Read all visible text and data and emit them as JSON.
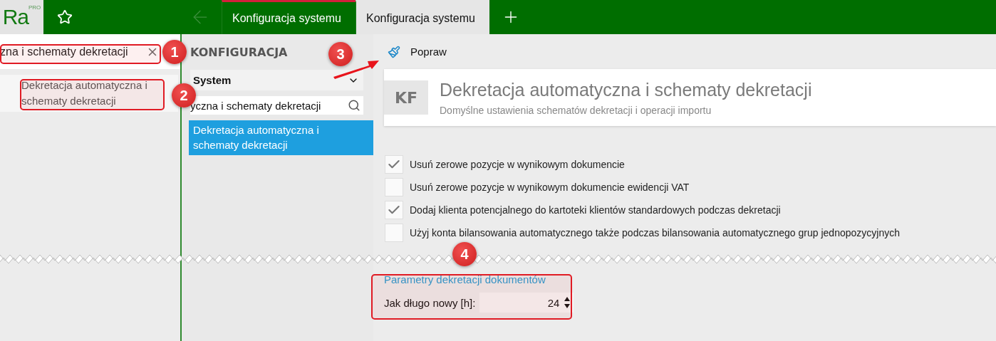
{
  "topbar": {
    "logo": {
      "text": "Ra",
      "badge": "PRO"
    },
    "tabs": [
      {
        "label": "Konfiguracja systemu",
        "selected": false
      },
      {
        "label": "Konfiguracja systemu",
        "selected": true
      }
    ]
  },
  "search_panel": {
    "search": {
      "value": "zna i schematy dekretacji"
    },
    "results": [
      {
        "label": "Dekretacja automatyczna i schematy dekretacji"
      }
    ]
  },
  "config_panel": {
    "title": "KONFIGURACJA",
    "category": {
      "value": "System"
    },
    "search": {
      "value": "yczna i schematy dekretacji"
    },
    "items": [
      {
        "label": "Dekretacja automatyczna i schematy dekretacji",
        "selected": true
      }
    ]
  },
  "toolbar": {
    "buttons": [
      {
        "label": "Popraw"
      }
    ]
  },
  "header": {
    "badge": "KF",
    "title": "Dekretacja automatyczna i schematy dekretacji",
    "subtitle": "Domyślne ustawienia schematów dekretacji i operacji importu"
  },
  "options": [
    {
      "label": "Usuń zerowe pozycje w wynikowym dokumencie",
      "checked": true
    },
    {
      "label": "Usuń zerowe pozycje w wynikowym dokumencie ewidencji VAT",
      "checked": false
    },
    {
      "label": "Dodaj klienta potencjalnego do kartoteki klientów standardowych podczas dekretacji",
      "checked": true
    },
    {
      "label": "Użyj konta bilansowania automatycznego także podczas bilansowania automatycznego grup jednopozycyjnych",
      "checked": false
    }
  ],
  "group": {
    "title": "Parametry dekretacji dokumentów",
    "fields": [
      {
        "label": "Jak długo nowy [h]:",
        "value": "24"
      }
    ]
  },
  "callouts": [
    "1",
    "2",
    "3",
    "4"
  ]
}
